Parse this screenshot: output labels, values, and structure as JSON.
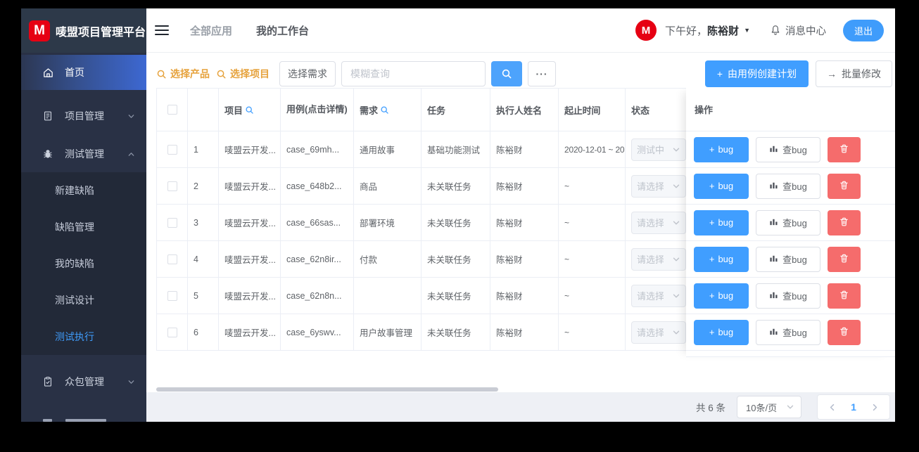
{
  "brand": {
    "logo_letter": "M",
    "title": "唛盟项目管理平台",
    "brand_red": "#e60013"
  },
  "header": {
    "tab_all_apps": "全部应用",
    "tab_workbench": "我的工作台",
    "greeting": "下午好，",
    "username": "陈裕财",
    "caret": "▼",
    "avatar_letter": "M",
    "message_center": "消息中心",
    "logout": "退出"
  },
  "sidebar": {
    "items": [
      {
        "label": "首页",
        "icon": "home-icon",
        "active": true
      },
      {
        "label": "项目管理",
        "icon": "document-icon",
        "state": "collapsed"
      },
      {
        "label": "测试管理",
        "icon": "bug-icon",
        "state": "expanded"
      },
      {
        "label": "众包管理",
        "icon": "clipboard-icon",
        "state": "collapsed"
      }
    ],
    "test_submenu": [
      {
        "label": "新建缺陷"
      },
      {
        "label": "缺陷管理"
      },
      {
        "label": "我的缺陷"
      },
      {
        "label": "测试设计"
      },
      {
        "label": "测试执行",
        "active": true
      }
    ]
  },
  "toolbar": {
    "select_product": "选择产品",
    "select_project": "选择项目",
    "select_requirement": "选择需求",
    "fuzzy_placeholder": "模糊查询",
    "more": "···",
    "create_plan_plus": "+",
    "create_plan": "由用例创建计划",
    "batch_arrow": "→",
    "batch_edit": "批量修改"
  },
  "table": {
    "columns": {
      "project": "项目",
      "case": "用例(点击详情)",
      "requirement": "需求",
      "task": "任务",
      "executor": "执行人姓名",
      "period": "起止时间",
      "status": "状态",
      "ops": "操作"
    },
    "rows": [
      {
        "index": "1",
        "project": "唛盟云开发...",
        "case": "case_69mh...",
        "requirement": "通用故事",
        "task": "基础功能测试",
        "executor": "陈裕财",
        "period": "2020-12-01 ~ 20",
        "status": "测试中"
      },
      {
        "index": "2",
        "project": "唛盟云开发...",
        "case": "case_648b2...",
        "requirement": "商品",
        "task": "未关联任务",
        "executor": "陈裕财",
        "period": "~",
        "status": "请选择"
      },
      {
        "index": "3",
        "project": "唛盟云开发...",
        "case": "case_66sas...",
        "requirement": "部署环境",
        "task": "未关联任务",
        "executor": "陈裕财",
        "period": "~",
        "status": "请选择"
      },
      {
        "index": "4",
        "project": "唛盟云开发...",
        "case": "case_62n8ir...",
        "requirement": "付款",
        "task": "未关联任务",
        "executor": "陈裕财",
        "period": "~",
        "status": "请选择"
      },
      {
        "index": "5",
        "project": "唛盟云开发...",
        "case": "case_62n8n...",
        "requirement": "",
        "task": "未关联任务",
        "executor": "陈裕财",
        "period": "~",
        "status": "请选择"
      },
      {
        "index": "6",
        "project": "唛盟云开发...",
        "case": "case_6yswv...",
        "requirement": "用户故事管理",
        "task": "未关联任务",
        "executor": "陈裕财",
        "period": "~",
        "status": "请选择"
      }
    ]
  },
  "ops": {
    "add_bug_plus": "+",
    "add_bug": "bug",
    "view_bug": "查bug"
  },
  "footer": {
    "total": "共 6 条",
    "page_size": "10条/页",
    "page": "1"
  },
  "colors": {
    "accent": "#409eff",
    "danger": "#f56c6c",
    "warning": "#e6a23c"
  }
}
